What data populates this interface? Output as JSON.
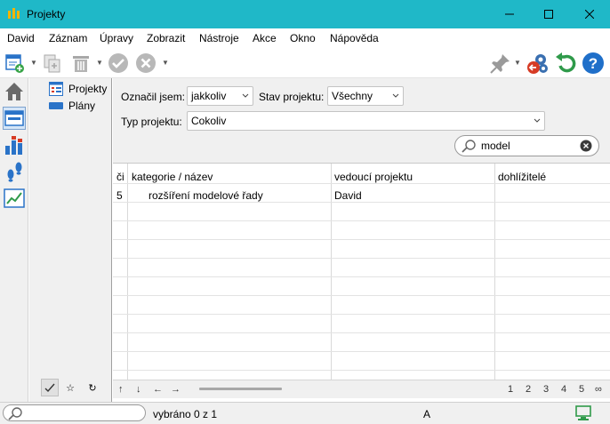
{
  "window": {
    "title": "Projekty"
  },
  "menu": [
    "David",
    "Záznam",
    "Úpravy",
    "Zobrazit",
    "Nástroje",
    "Akce",
    "Okno",
    "Nápověda"
  ],
  "toolbar": {
    "icons": [
      "new-record-icon",
      "copy-record-icon",
      "delete-icon",
      "confirm-icon",
      "cancel-icon",
      "pin-icon",
      "settings-icon",
      "undo-icon",
      "help-icon"
    ]
  },
  "nav": {
    "items": [
      {
        "label": "Projekty"
      },
      {
        "label": "Plány"
      }
    ]
  },
  "filters": {
    "marked_label": "Označil jsem:",
    "marked_value": "jakkoliv",
    "state_label": "Stav projektu:",
    "state_value": "Všechny",
    "type_label": "Typ projektu:",
    "type_value": "Cokoliv",
    "search_value": "model"
  },
  "grid": {
    "columns": [
      "či",
      "kategorie / název",
      "vedoucí projektu",
      "dohlížitelé"
    ],
    "rows": [
      [
        "5",
        "rozšíření modelové řady",
        "David",
        ""
      ]
    ]
  },
  "grid_footer": {
    "nav": [
      "↑",
      "↓",
      "←",
      "→"
    ],
    "pages": [
      "1",
      "2",
      "3",
      "4",
      "5",
      "∞"
    ]
  },
  "status": {
    "selection": "vybráno 0 z 1",
    "mode": "A"
  },
  "colors": {
    "titlebar": "#1fb8c8",
    "accent": "#2a73c8"
  }
}
